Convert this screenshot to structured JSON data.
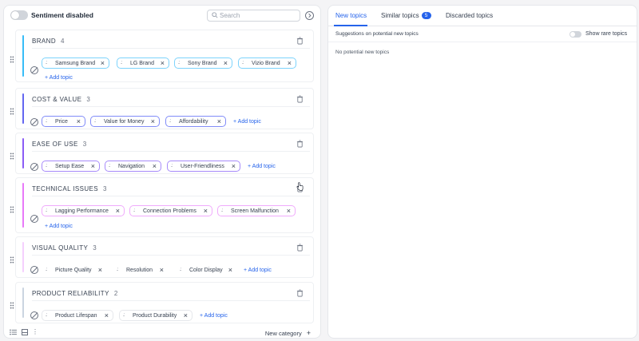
{
  "colors": {
    "accent_blue": "#2563eb",
    "brand": "#38bdf8",
    "cost_value": "#6366f1",
    "ease_of_use": "#8b5cf6",
    "technical_issues": "#e879f9",
    "visual_quality": "#f0abfc",
    "product_reliability": "#cbd5e1"
  },
  "topbar": {
    "sentiment_label": "Sentiment disabled",
    "search_placeholder": "Search"
  },
  "categories": [
    {
      "name": "BRAND",
      "count": "4",
      "topics": [
        "Samsung Brand",
        "LG Brand",
        "Sony Brand",
        "Vizio Brand"
      ],
      "add_label": "+ Add topic"
    },
    {
      "name": "COST & VALUE",
      "count": "3",
      "topics": [
        "Price",
        "Value for Money",
        "Affordability"
      ],
      "add_label": "+ Add topic"
    },
    {
      "name": "EASE OF USE",
      "count": "3",
      "topics": [
        "Setup Ease",
        "Navigation",
        "User-Friendliness"
      ],
      "add_label": "+ Add topic"
    },
    {
      "name": "TECHNICAL ISSUES",
      "count": "3",
      "topics": [
        "Lagging Performance",
        "Connection Problems",
        "Screen Malfunction"
      ],
      "add_label": "+ Add topic"
    },
    {
      "name": "VISUAL QUALITY",
      "count": "3",
      "topics": [
        "Picture Quality",
        "Resolution",
        "Color Display"
      ],
      "add_label": "+ Add topic"
    },
    {
      "name": "PRODUCT RELIABILITY",
      "count": "2",
      "topics": [
        "Product Lifespan",
        "Product Durability"
      ],
      "add_label": "+ Add topic"
    }
  ],
  "bottombar": {
    "new_category": "New category"
  },
  "right": {
    "tabs": [
      {
        "label": "New topics"
      },
      {
        "label": "Similar topics",
        "badge": "5"
      },
      {
        "label": "Discarded topics"
      }
    ],
    "suggestions_label": "Suggestions on potential new topics",
    "rare_label": "Show rare topics",
    "empty_message": "No potential new topics"
  }
}
